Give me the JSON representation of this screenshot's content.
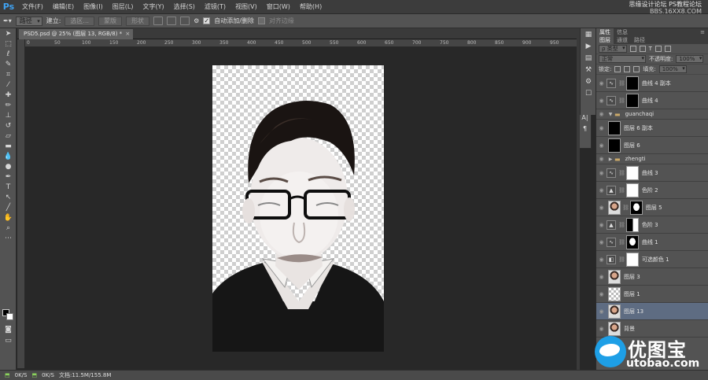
{
  "app": {
    "logo": "Ps"
  },
  "menu": [
    "文件(F)",
    "编辑(E)",
    "图像(I)",
    "图层(L)",
    "文字(Y)",
    "选择(S)",
    "滤镜(T)",
    "视图(V)",
    "窗口(W)",
    "帮助(H)"
  ],
  "watermark_top": {
    "line1": "思缘设计论坛",
    "line1b": "PS教程论坛",
    "line2": "BBS.16XX8.COM"
  },
  "options": {
    "tool_mode": "路径",
    "build_label": "建立:",
    "selection_btn": "选区...",
    "mask_btn": "蒙版",
    "shape_btn": "形状",
    "auto_add_delete": "自动添加/删除",
    "align_edges": "对齐边缘"
  },
  "document": {
    "tab_title": "PSD5.psd @ 25% (图层 13, RGB/8) *",
    "close": "×"
  },
  "ruler": {
    "ticks": [
      "0",
      "50",
      "100",
      "150",
      "200",
      "250",
      "300",
      "350",
      "400",
      "450",
      "500",
      "550",
      "600",
      "650",
      "700",
      "750",
      "800",
      "850",
      "900",
      "950",
      "1000"
    ]
  },
  "layers_panel": {
    "tabs": [
      "属性",
      "信息"
    ],
    "subtabs": [
      "图层",
      "通道",
      "路径"
    ],
    "filter_label": "ρ 类型",
    "blend_mode": "正常",
    "opacity_label": "不透明度:",
    "opacity_value": "100%",
    "lock_label": "锁定:",
    "fill_label": "填充:",
    "fill_value": "100%",
    "layers": [
      {
        "name": "曲线 4 副本",
        "kind": "adjust",
        "mask": "dots"
      },
      {
        "name": "曲线 4",
        "kind": "adjust",
        "mask": "dots"
      },
      {
        "name": "guanchaqi",
        "kind": "group",
        "open": true
      },
      {
        "name": "图层 6 副本",
        "kind": "pixel",
        "thumb": "black"
      },
      {
        "name": "图层 6",
        "kind": "pixel",
        "thumb": "black"
      },
      {
        "name": "zhengti",
        "kind": "group",
        "open": false
      },
      {
        "name": "曲线 3",
        "kind": "adjust",
        "mask": "white"
      },
      {
        "name": "色阶 2",
        "kind": "levels",
        "mask": "white"
      },
      {
        "name": "图层 5",
        "kind": "pixel-masked",
        "thumb": "face",
        "mask": "mask"
      },
      {
        "name": "色阶 3",
        "kind": "levels",
        "mask": "black-white"
      },
      {
        "name": "曲线 1",
        "kind": "adjust",
        "mask": "mask"
      },
      {
        "name": "可选颜色 1",
        "kind": "selective",
        "mask": "white"
      },
      {
        "name": "图层 3",
        "kind": "pixel",
        "thumb": "face"
      },
      {
        "name": "图层 1",
        "kind": "pixel",
        "thumb": "checker"
      },
      {
        "name": "图层 13",
        "kind": "pixel",
        "thumb": "face",
        "selected": true
      },
      {
        "name": "背景",
        "kind": "pixel",
        "thumb": "face"
      }
    ]
  },
  "status": {
    "left": "0K/S",
    "mid": "0K/S",
    "doc": "文档:11.5M/155.8M"
  },
  "watermark_bottom": {
    "title": "优图宝",
    "url": "utobao.com"
  }
}
